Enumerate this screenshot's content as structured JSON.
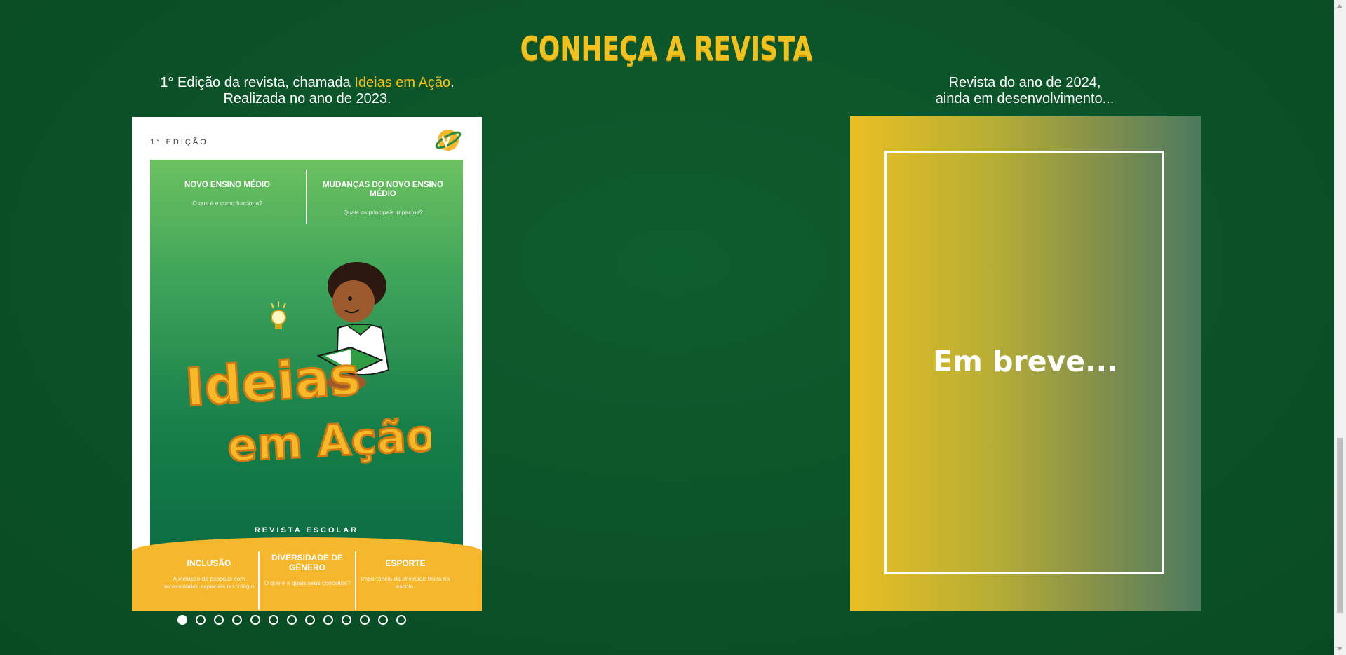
{
  "section": {
    "title": "CONHEÇA A REVISTA"
  },
  "left": {
    "caption_pre": "1° Edição da revista, chamada ",
    "caption_highlight": "Ideias em Ação",
    "caption_post": ".",
    "caption_line2": "Realizada no ano de 2023.",
    "cover": {
      "edition": "1° EDIÇÃO",
      "topic1_title": "NOVO ENSINO MÉDIO",
      "topic1_sub": "O que é e como funciona?",
      "topic2_title": "MUDANÇAS DO NOVO ENSINO MÉDIO",
      "topic2_sub": "Quais os principais impactos?",
      "logo_title_line1": "Ideias",
      "logo_title_line2": "em Ação",
      "school_label": "REVISTA ESCOLAR",
      "b1_title": "INCLUSÃO",
      "b1_sub": "A inclusão de pessoas com necessidades especiais no colégio.",
      "b2_title": "DIVERSIDADE DE GÊNERO",
      "b2_sub": "O que é e quais seus conceitos?",
      "b3_title": "ESPORTE",
      "b3_sub": "Importância da atividade física na escola."
    },
    "carousel": {
      "total": 13,
      "active": 1
    }
  },
  "right": {
    "caption_line1": "Revista do ano de 2024,",
    "caption_line2": "ainda em desenvolvimento...",
    "soon_text": "Em breve..."
  },
  "colors": {
    "background": "#0b5128",
    "accent_yellow": "#f1c21f",
    "cover_band": "#f4b72e"
  }
}
